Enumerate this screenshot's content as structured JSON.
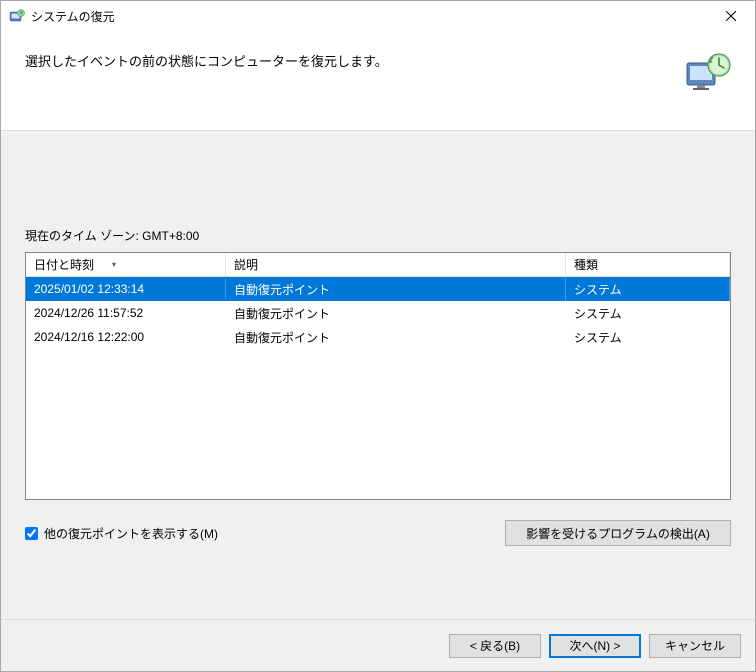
{
  "window": {
    "title": "システムの復元"
  },
  "header": {
    "description": "選択したイベントの前の状態にコンピューターを復元します。"
  },
  "timezone": {
    "label": "現在のタイム ゾーン: GMT+8:00"
  },
  "table": {
    "columns": {
      "date": "日付と時刻",
      "desc": "説明",
      "type": "種類"
    },
    "rows": [
      {
        "date": "2025/01/02 12:33:14",
        "desc": "自動復元ポイント",
        "type": "システム",
        "selected": true
      },
      {
        "date": "2024/12/26 11:57:52",
        "desc": "自動復元ポイント",
        "type": "システム",
        "selected": false
      },
      {
        "date": "2024/12/16 12:22:00",
        "desc": "自動復元ポイント",
        "type": "システム",
        "selected": false
      }
    ]
  },
  "showMore": {
    "label": "他の復元ポイントを表示する(M)",
    "checked": true
  },
  "scanButton": {
    "label": "影響を受けるプログラムの検出(A)"
  },
  "footer": {
    "back": "< 戻る(B)",
    "next": "次へ(N) >",
    "cancel": "キャンセル"
  }
}
